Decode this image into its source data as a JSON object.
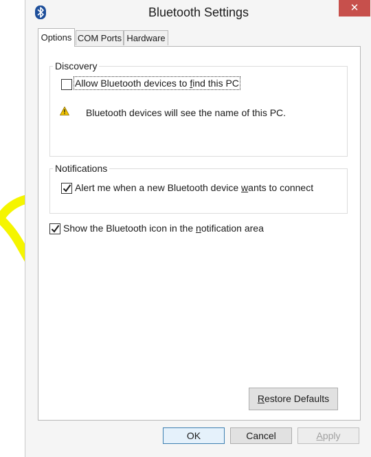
{
  "window": {
    "title": "Bluetooth Settings",
    "close_label": "✕"
  },
  "tabs": [
    {
      "label": "Options",
      "active": true
    },
    {
      "label": "COM Ports",
      "active": false
    },
    {
      "label": "Hardware",
      "active": false
    }
  ],
  "discovery": {
    "legend": "Discovery",
    "allow_checkbox": {
      "pre": "Allow Bluetooth devices to ",
      "accel": "f",
      "post": "ind this PC",
      "checked": false
    },
    "warning_text": "Bluetooth devices will see the name of this PC."
  },
  "notifications": {
    "legend": "Notifications",
    "alert_checkbox": {
      "pre": "Alert me when a new Bluetooth device ",
      "accel": "w",
      "post": "ants to connect",
      "checked": true
    }
  },
  "show_icon_checkbox": {
    "pre": "Show the Bluetooth icon in the ",
    "accel": "n",
    "post": "otification area",
    "checked": true
  },
  "buttons": {
    "restore": {
      "accel": "R",
      "post": "estore Defaults"
    },
    "ok": "OK",
    "cancel": "Cancel",
    "apply": {
      "accel": "A",
      "post": "pply"
    }
  },
  "colors": {
    "highlight": "#f5f500",
    "close_button": "#c7504c",
    "warning_icon": "#f2c500"
  }
}
